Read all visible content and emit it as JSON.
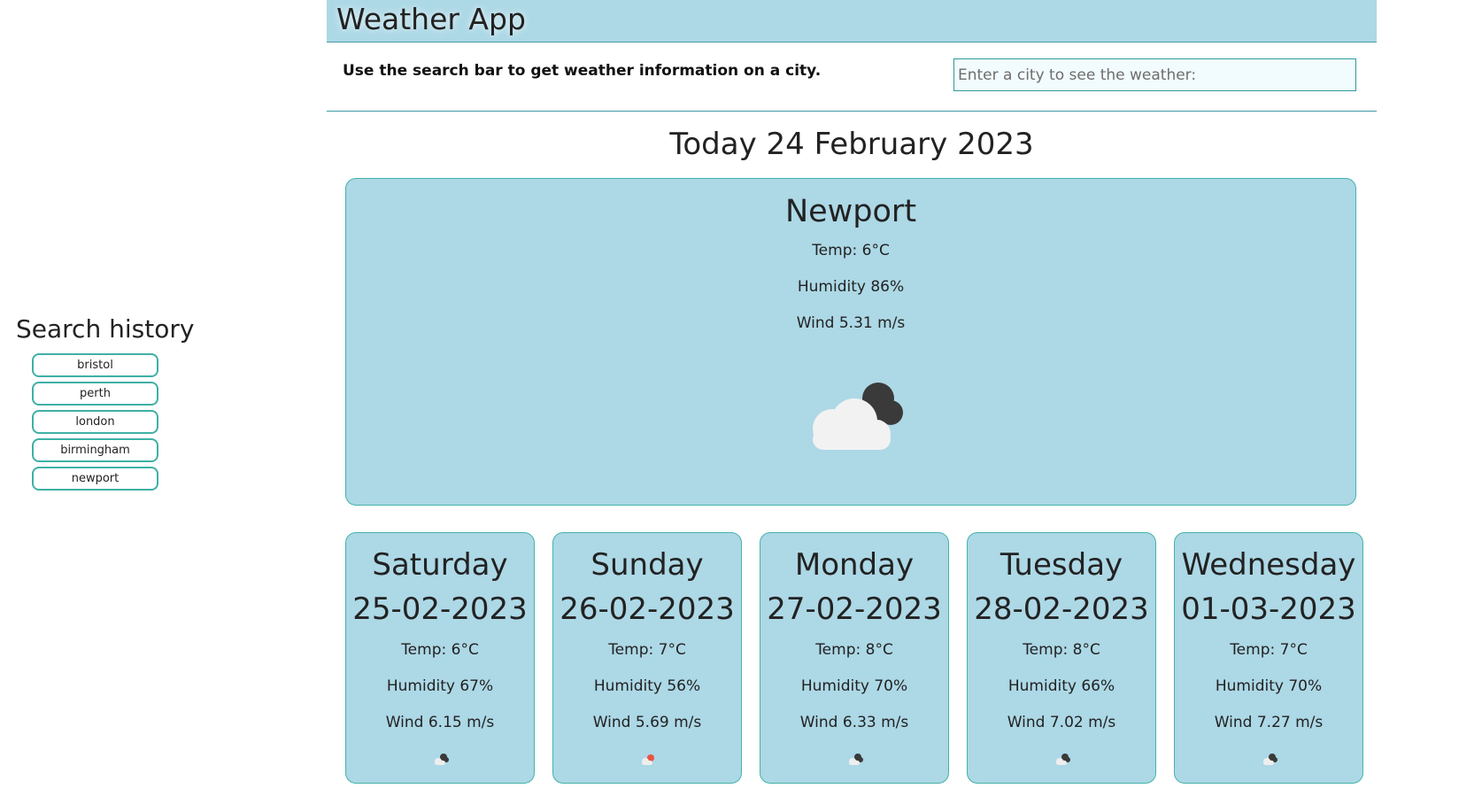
{
  "header": {
    "title": "Weather App"
  },
  "search": {
    "instruction": "Use the search bar to get weather information on a city.",
    "placeholder": "Enter a city to see the weather:"
  },
  "today": {
    "heading": "Today 24 February 2023",
    "city": "Newport",
    "temp": "Temp: 6°C",
    "humidity": "Humidity 86%",
    "wind": "Wind 5.31 m/s",
    "icon": "cloud-moon-icon"
  },
  "history": {
    "title": "Search history",
    "items": [
      "bristol",
      "perth",
      "london",
      "birmingham",
      "newport"
    ]
  },
  "forecast": [
    {
      "day": "Saturday",
      "date": "25-02-2023",
      "temp": "Temp: 6°C",
      "humidity": "Humidity 67%",
      "wind": "Wind 6.15 m/s",
      "icon": "cloud-moon-icon"
    },
    {
      "day": "Sunday",
      "date": "26-02-2023",
      "temp": "Temp: 7°C",
      "humidity": "Humidity 56%",
      "wind": "Wind 5.69 m/s",
      "icon": "cloud-sun-icon"
    },
    {
      "day": "Monday",
      "date": "27-02-2023",
      "temp": "Temp: 8°C",
      "humidity": "Humidity 70%",
      "wind": "Wind 6.33 m/s",
      "icon": "cloud-moon-icon"
    },
    {
      "day": "Tuesday",
      "date": "28-02-2023",
      "temp": "Temp: 8°C",
      "humidity": "Humidity 66%",
      "wind": "Wind 7.02 m/s",
      "icon": "cloud-moon-icon"
    },
    {
      "day": "Wednesday",
      "date": "01-03-2023",
      "temp": "Temp: 7°C",
      "humidity": "Humidity 70%",
      "wind": "Wind 7.27 m/s",
      "icon": "cloud-moon-icon"
    }
  ],
  "colors": {
    "card_bg": "#add8e6",
    "card_border": "#45b3a9",
    "button_border": "#3fb0a6",
    "input_bg": "#f2fbfd"
  }
}
